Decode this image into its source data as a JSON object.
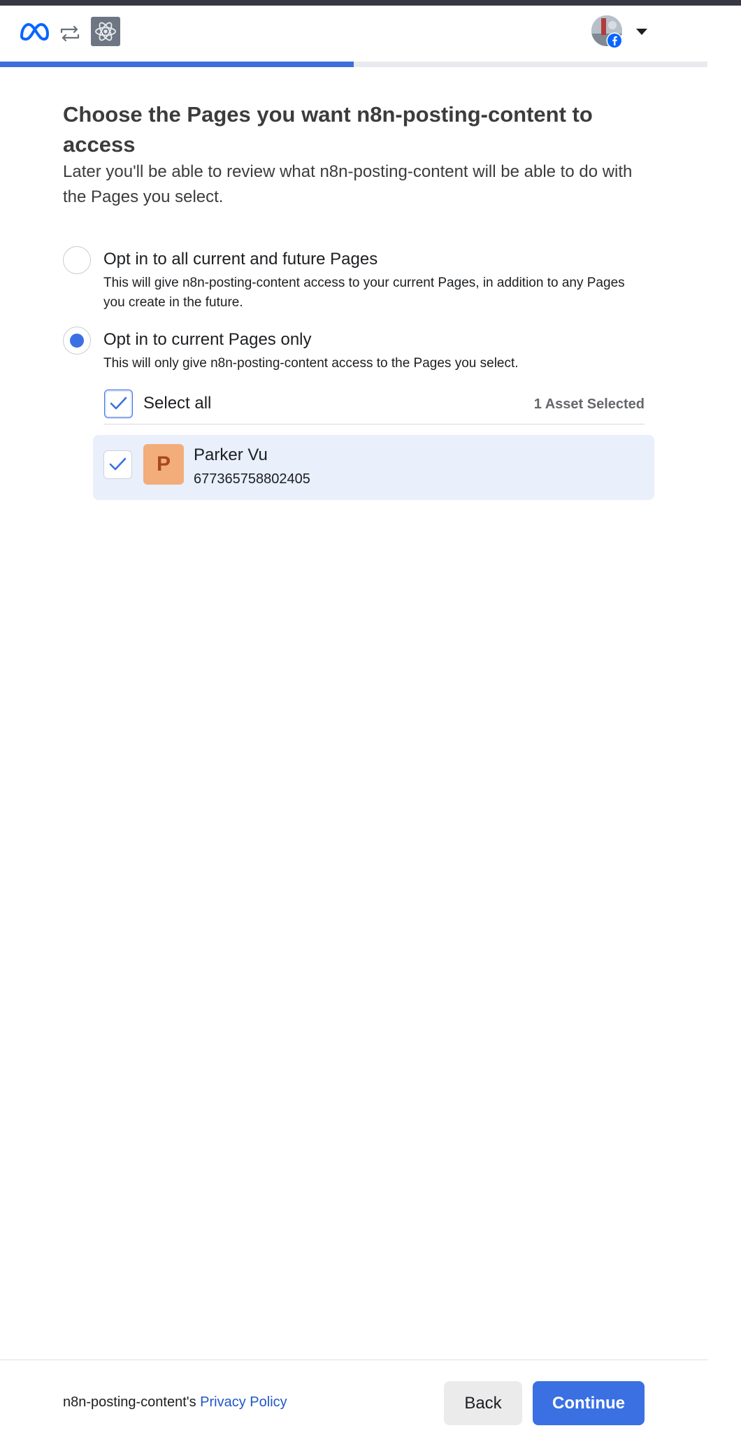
{
  "header": {
    "logo_icon": "meta-infinity-icon",
    "connect_icon": "arrows-exchange-icon",
    "app_icon": "atom-icon",
    "avatar_badge_icon": "facebook-icon",
    "menu_icon": "caret-down-icon",
    "progress_fraction": 0.5,
    "colors": {
      "accent": "#3a70e2",
      "strip": "#373844"
    }
  },
  "main": {
    "title": "Choose the Pages you want n8n-posting-content to access",
    "subtitle": "Later you'll be able to review what n8n-posting-content will be able to do with the Pages you select.",
    "options": [
      {
        "title": "Opt in to all current and future Pages",
        "description": "This will give n8n-posting-content access to your current Pages, in addition to any Pages you create in the future.",
        "selected": false
      },
      {
        "title": "Opt in to current Pages only",
        "description": "This will only give n8n-posting-content access to the Pages you select.",
        "selected": true
      }
    ],
    "select_all_label": "Select all",
    "asset_count": "1 Asset Selected",
    "pages": [
      {
        "initial": "P",
        "name": "Parker Vu",
        "id": "677365758802405",
        "checked": true
      }
    ]
  },
  "footer": {
    "policy_prefix": "n8n-posting-content's ",
    "policy_link": "Privacy Policy",
    "back_label": "Back",
    "continue_label": "Continue"
  }
}
